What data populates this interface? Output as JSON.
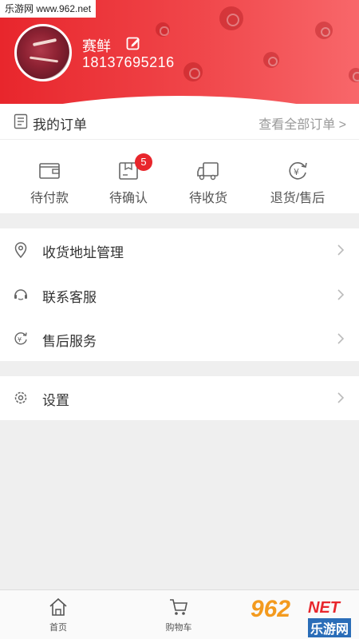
{
  "watermark": "乐游网 www.962.net",
  "profile": {
    "username": "赛鲜",
    "phone": "18137695216"
  },
  "orders": {
    "title": "我的订单",
    "view_all": "查看全部订单 >",
    "items": [
      {
        "label": "待付款",
        "icon": "wallet-icon"
      },
      {
        "label": "待确认",
        "icon": "box-icon",
        "badge": "5"
      },
      {
        "label": "待收货",
        "icon": "truck-icon"
      },
      {
        "label": "退货/售后",
        "icon": "refund-icon"
      }
    ]
  },
  "menu": {
    "items": [
      {
        "label": "收货地址管理",
        "icon": "location-pin-icon"
      },
      {
        "label": "联系客服",
        "icon": "headset-icon"
      },
      {
        "label": "售后服务",
        "icon": "refund-icon"
      }
    ],
    "settings": {
      "label": "设置",
      "icon": "gear-icon"
    }
  },
  "tabbar": {
    "items": [
      {
        "label": "首页",
        "icon": "home-icon"
      },
      {
        "label": "购物车",
        "icon": "cart-icon"
      }
    ]
  },
  "brand_logo": {
    "number": "962",
    "net": "NET",
    "name": "乐游网"
  },
  "colors": {
    "accent": "#e8262c",
    "badge": "#e8262c",
    "background": "#efefef"
  }
}
